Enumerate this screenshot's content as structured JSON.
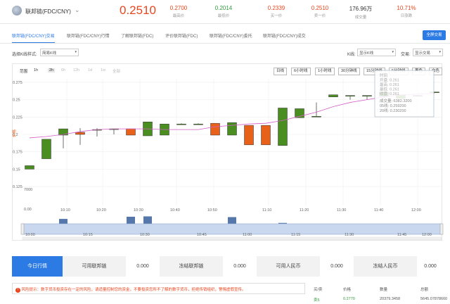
{
  "header": {
    "pair": "联邦链(FDC/CNY)",
    "price": "0.2510",
    "stats": [
      {
        "value": "0.2700",
        "label": "最高价",
        "tone": "red"
      },
      {
        "value": "0.2014",
        "label": "最低价",
        "tone": "green"
      },
      {
        "value": "0.2339",
        "label": "买一价",
        "tone": "red"
      },
      {
        "value": "0.2510",
        "label": "卖一价",
        "tone": "red"
      },
      {
        "value": "176.96万",
        "label": "成交量",
        "tone": "dark"
      },
      {
        "value": "10.71%",
        "label": "日涨跌",
        "tone": "red"
      }
    ]
  },
  "tabs": [
    "联邦链(FDC/CNY)交易",
    "联邦链(FDC/CNY)行情",
    "了解联邦链(FDC)",
    "评价联邦链(FDC)",
    "联邦链(FDC/CNY)委托",
    "联邦链(FDC/CNY)成交"
  ],
  "fullscreen_label": "全屏交易",
  "controls": {
    "style_label": "选择K线样式:",
    "style_value": "简易K线",
    "kline_label": "K线:",
    "kline_value": "显示K线",
    "trade_label": "交易:",
    "trade_value": "显示交易"
  },
  "range": {
    "label": "范围",
    "options": [
      "1h",
      "2h",
      "6h",
      "12h",
      "1d",
      "1w",
      "全部"
    ],
    "active": "2h",
    "disabled": [
      "6h",
      "12h",
      "1d",
      "1w",
      "全部"
    ]
  },
  "intervals": [
    "日线",
    "6小时线",
    "1小时线",
    "30分钟线",
    "15分钟线",
    "5分钟线",
    "黑色",
    "白色"
  ],
  "tooltip": {
    "title": "时间",
    "rows": [
      "开盘: 0.261",
      "最高: 0.261",
      "最低: 0.261",
      "收盘: 0.261"
    ],
    "volume": "成交量: 6382.3200",
    "ma5": "05线: 0.259200",
    "ma20": "20线: 0.230200"
  },
  "chart_data": {
    "type": "candlestick",
    "y_ticks": [
      "0.275",
      "0.25",
      "0.225",
      "0.2",
      "0.175",
      "0.15",
      "0.125"
    ],
    "ylim": [
      0.12,
      0.28
    ],
    "y_unit_label": "价格",
    "vol_ticks": [
      "7000",
      "0.00"
    ],
    "time_ticks": [
      "10:10",
      "10:20",
      "10:30",
      "10:40",
      "10:50",
      "11:10",
      "11:20",
      "11:30",
      "11:40",
      "12:00"
    ],
    "nav_ticks": [
      "10:00",
      "10:15",
      "10:30",
      "10:45",
      "11:00",
      "11:15",
      "11:30",
      "11:45",
      "12:00"
    ],
    "candles": [
      {
        "o": 0.15,
        "c": 0.155,
        "h": 0.155,
        "l": 0.15,
        "v": 900
      },
      {
        "o": 0.165,
        "c": 0.193,
        "h": 0.193,
        "l": 0.165,
        "v": 600
      },
      {
        "o": 0.199,
        "c": 0.208,
        "h": 0.208,
        "l": 0.18,
        "v": 2900
      },
      {
        "o": 0.203,
        "c": 0.2,
        "h": 0.209,
        "l": 0.185,
        "v": 400
      },
      {
        "o": 0.207,
        "c": 0.207,
        "h": 0.209,
        "l": 0.197,
        "v": 200
      },
      {
        "o": 0.208,
        "c": 0.208,
        "h": 0.208,
        "l": 0.2,
        "v": 150
      },
      {
        "o": 0.208,
        "c": 0.199,
        "h": 0.208,
        "l": 0.199,
        "v": 3500
      },
      {
        "o": 0.198,
        "c": 0.218,
        "h": 0.218,
        "l": 0.198,
        "v": 3600
      },
      {
        "o": 0.199,
        "c": 0.215,
        "h": 0.215,
        "l": 0.199,
        "v": 600
      },
      {
        "o": 0.215,
        "c": 0.215,
        "h": 0.216,
        "l": 0.214,
        "v": 100
      },
      {
        "o": 0.215,
        "c": 0.215,
        "h": 0.216,
        "l": 0.214,
        "v": 100
      },
      {
        "o": 0.216,
        "c": 0.199,
        "h": 0.216,
        "l": 0.199,
        "v": 300
      },
      {
        "o": 0.199,
        "c": 0.217,
        "h": 0.217,
        "l": 0.199,
        "v": 3400
      },
      {
        "o": 0.213,
        "c": 0.185,
        "h": 0.213,
        "l": 0.185,
        "v": 900
      },
      {
        "o": 0.213,
        "c": 0.185,
        "h": 0.213,
        "l": 0.185,
        "v": 1500
      },
      {
        "o": 0.184,
        "c": 0.238,
        "h": 0.238,
        "l": 0.184,
        "v": 1800
      },
      {
        "o": 0.224,
        "c": 0.237,
        "h": 0.237,
        "l": 0.224,
        "v": 1000
      },
      {
        "o": 0.226,
        "c": 0.226,
        "h": 0.246,
        "l": 0.226,
        "v": 150
      },
      {
        "o": 0.254,
        "c": 0.257,
        "h": 0.257,
        "l": 0.254,
        "v": 300
      },
      {
        "o": 0.256,
        "c": 0.256,
        "h": 0.256,
        "l": 0.25,
        "v": 200
      },
      {
        "o": 0.256,
        "c": 0.256,
        "h": 0.256,
        "l": 0.25,
        "v": 300
      },
      {
        "o": 0.255,
        "c": 0.261,
        "h": 0.261,
        "l": 0.252,
        "v": 250
      },
      {
        "o": 0.252,
        "c": 0.257,
        "h": 0.257,
        "l": 0.252,
        "v": 500
      },
      {
        "o": 0.256,
        "c": 0.256,
        "h": 0.257,
        "l": 0.255,
        "v": 300
      },
      {
        "o": 0.261,
        "c": 0.261,
        "h": 0.261,
        "l": 0.261,
        "v": 200
      }
    ],
    "ma": [
      0.195,
      0.197,
      0.2,
      0.204,
      0.207,
      0.208,
      0.208,
      0.208,
      0.207,
      0.207,
      0.207,
      0.211,
      0.213,
      0.215,
      0.216,
      0.22,
      0.226,
      0.232,
      0.24,
      0.246,
      0.25,
      0.254,
      0.257,
      0.258,
      0.259
    ]
  },
  "bottom_tabs": [
    {
      "label": "今日行情",
      "active": true
    },
    {
      "label": "可用联邦链",
      "active": false
    },
    {
      "label": "0.000",
      "active": false
    },
    {
      "label": "冻结联邦链",
      "active": false
    },
    {
      "label": "0.000",
      "active": false
    },
    {
      "label": "可用人民币",
      "active": false
    },
    {
      "label": "0.000",
      "active": false
    },
    {
      "label": "冻结人民币",
      "active": false
    },
    {
      "label": "0.000",
      "active": false
    }
  ],
  "risk_notice": "风险提示：数字货币投资存在一定的风险，请适量控制您的资金，不要投资您所不了解的数字货币，拒绝传销组织，警惕虚假宣传。",
  "orderbook": {
    "headers": [
      "买/卖",
      "价格",
      "数量",
      "总额"
    ],
    "row": [
      "卖5",
      "0.2770",
      "20379.3458",
      "5645.07878660"
    ]
  },
  "colors": {
    "up": "#4a8d20",
    "down": "#e8611a",
    "accent": "#2c7be5",
    "ma": "#d45ec8"
  }
}
